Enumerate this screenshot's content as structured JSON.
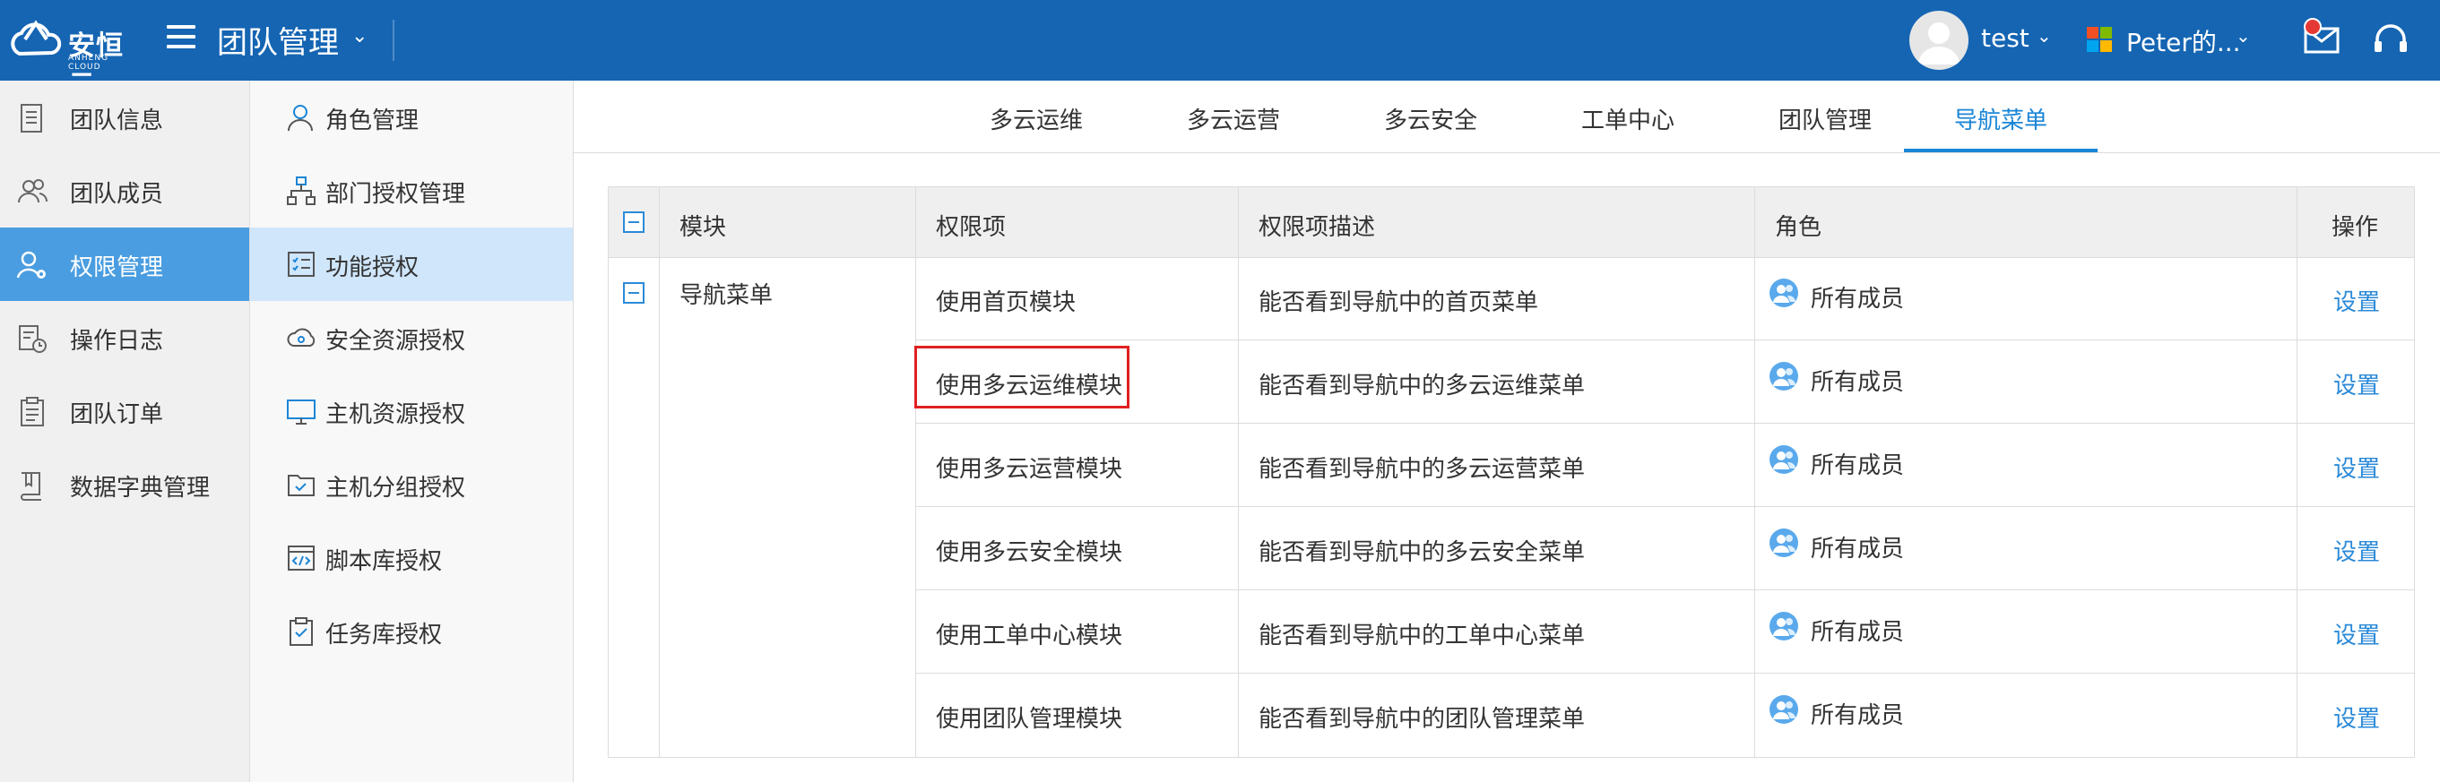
{
  "header": {
    "logo_text": "安恒云",
    "logo_sub": "ANHENG CLOUD",
    "app_title": "团队管理",
    "user_name": "test",
    "org_name": "Peter的..."
  },
  "left_nav": [
    {
      "label": "团队信息",
      "icon": "document-icon",
      "active": false
    },
    {
      "label": "团队成员",
      "icon": "users-icon",
      "active": false
    },
    {
      "label": "权限管理",
      "icon": "user-gear-icon",
      "active": true
    },
    {
      "label": "操作日志",
      "icon": "log-icon",
      "active": false
    },
    {
      "label": "团队订单",
      "icon": "clipboard-icon",
      "active": false
    },
    {
      "label": "数据字典管理",
      "icon": "book-icon",
      "active": false
    }
  ],
  "sub_nav": [
    {
      "label": "角色管理",
      "icon": "role-icon",
      "active": false
    },
    {
      "label": "部门授权管理",
      "icon": "org-chart-icon",
      "active": false
    },
    {
      "label": "功能授权",
      "icon": "checklist-icon",
      "active": true
    },
    {
      "label": "安全资源授权",
      "icon": "cloud-icon",
      "active": false
    },
    {
      "label": "主机资源授权",
      "icon": "monitor-icon",
      "active": false
    },
    {
      "label": "主机分组授权",
      "icon": "folder-check-icon",
      "active": false
    },
    {
      "label": "脚本库授权",
      "icon": "code-icon",
      "active": false
    },
    {
      "label": "任务库授权",
      "icon": "task-icon",
      "active": false
    }
  ],
  "tabs": [
    {
      "label": "多云运维",
      "active": false
    },
    {
      "label": "多云运营",
      "active": false
    },
    {
      "label": "多云安全",
      "active": false
    },
    {
      "label": "工单中心",
      "active": false
    },
    {
      "label": "团队管理",
      "active": false
    },
    {
      "label": "导航菜单",
      "active": true
    }
  ],
  "table": {
    "columns": [
      "模块",
      "权限项",
      "权限项描述",
      "角色",
      "操作"
    ],
    "module": "导航菜单",
    "rows": [
      {
        "permission": "使用首页模块",
        "description": "能否看到导航中的首页菜单",
        "role": "所有成员",
        "action": "设置"
      },
      {
        "permission": "使用多云运维模块",
        "description": "能否看到导航中的多云运维菜单",
        "role": "所有成员",
        "action": "设置"
      },
      {
        "permission": "使用多云运营模块",
        "description": "能否看到导航中的多云运营菜单",
        "role": "所有成员",
        "action": "设置"
      },
      {
        "permission": "使用多云安全模块",
        "description": "能否看到导航中的多云安全菜单",
        "role": "所有成员",
        "action": "设置"
      },
      {
        "permission": "使用工单中心模块",
        "description": "能否看到导航中的工单中心菜单",
        "role": "所有成员",
        "action": "设置"
      },
      {
        "permission": "使用团队管理模块",
        "description": "能否看到导航中的团队管理菜单",
        "role": "所有成员",
        "action": "设置"
      }
    ]
  },
  "colors": {
    "header_bg": "#1565b3",
    "active_nav": "#4a9de0",
    "active_sub": "#cfe6fb",
    "accent": "#1a85d6",
    "highlight": "#e02020"
  }
}
